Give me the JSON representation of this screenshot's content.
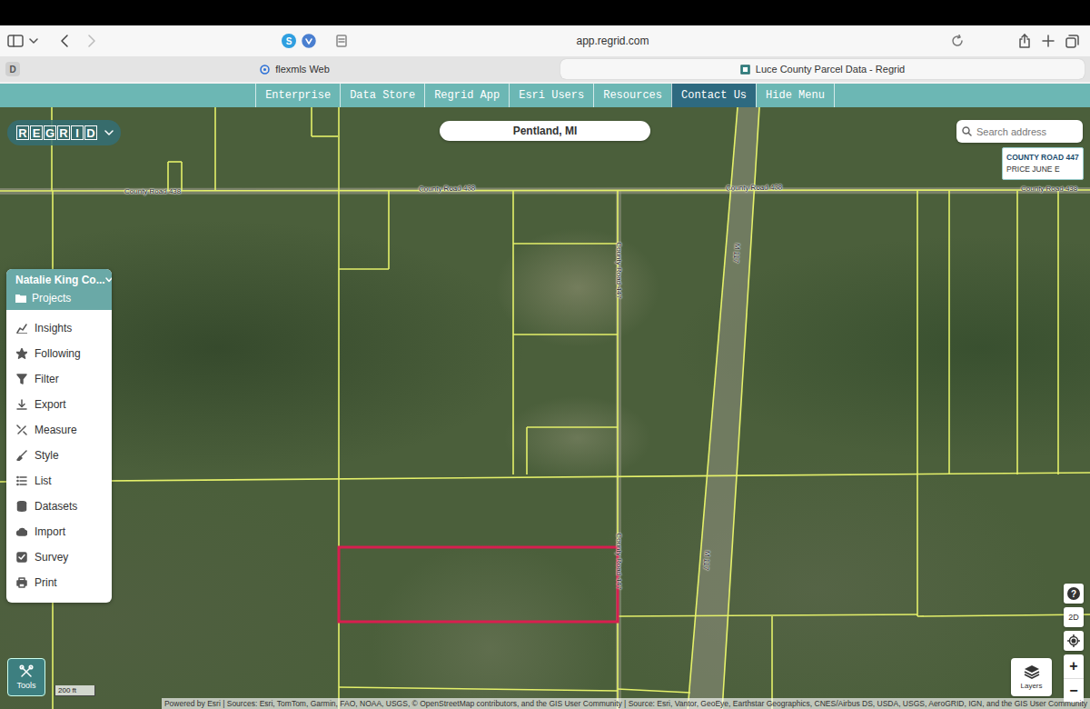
{
  "browser": {
    "extension_badge": "S",
    "url": "app.regrid.com",
    "profile_badge": "D",
    "tabs": [
      {
        "label": "flexmls Web",
        "selected": false
      },
      {
        "label": "Luce County Parcel Data - Regrid",
        "selected": true
      }
    ]
  },
  "nav": [
    {
      "label": "Enterprise",
      "selected": false
    },
    {
      "label": "Data Store",
      "selected": false
    },
    {
      "label": "Regrid App",
      "selected": false
    },
    {
      "label": "Esri Users",
      "selected": false
    },
    {
      "label": "Resources",
      "selected": false
    },
    {
      "label": "Contact Us",
      "selected": true
    },
    {
      "label": "Hide Menu",
      "selected": false
    }
  ],
  "map": {
    "logo": "REGRID",
    "location": "Pentland, MI",
    "search": {
      "placeholder": "Search address"
    },
    "tooltip": {
      "title": "COUNTY ROAD 447",
      "subtitle": "PRICE JUNE E"
    },
    "road_labels": [
      "County Road 438",
      "County Road 438",
      "County Road 438",
      "County Road 438",
      "County Road 447",
      "County Road 447",
      "M 117",
      "M 117"
    ],
    "selected_parcel": {
      "selected": true
    },
    "scale": "200 ft",
    "attribution": "Powered by Esri | Sources: Esri, TomTom, Garmin, FAO, NOAA, USGS, © OpenStreetMap contributors, and the GIS User Community | Source: Esri, Vantor, GeoEye, Earthstar Geographics, CNES/Airbus DS, USDA, USGS, AeroGRID, IGN, and the GIS User Community",
    "controls": {
      "help": "?",
      "view": "2D",
      "zoom_in": "+",
      "zoom_out": "−",
      "layers": "Layers"
    }
  },
  "panel": {
    "title": "Natalie King Co...",
    "projects": "Projects",
    "items": [
      "Insights",
      "Following",
      "Filter",
      "Export",
      "Measure",
      "Style",
      "List",
      "Datasets",
      "Import",
      "Survey",
      "Print"
    ]
  },
  "tools": {
    "label": "Tools"
  }
}
